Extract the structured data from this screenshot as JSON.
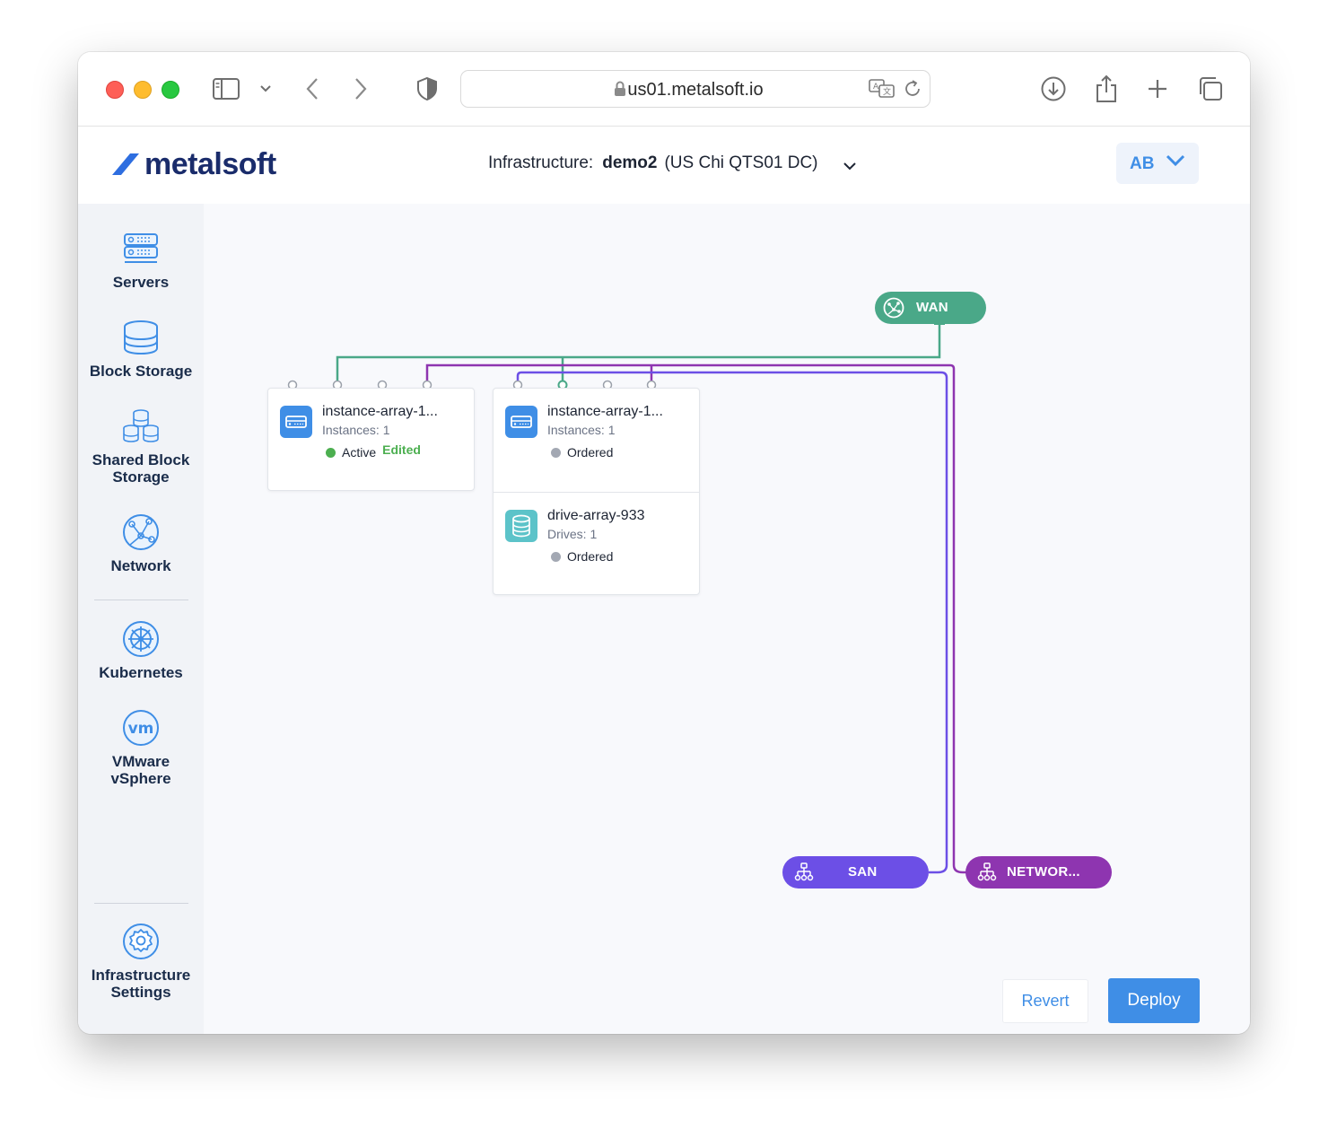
{
  "browser": {
    "url": "us01.metalsoft.io"
  },
  "header": {
    "logo_text": "metalsoft",
    "infra_label": "Infrastructure:",
    "infra_name": "demo2",
    "infra_location": "(US Chi QTS01 DC)",
    "user_initials": "AB"
  },
  "sidebar": {
    "items": [
      {
        "label": "Servers",
        "icon": "server-icon"
      },
      {
        "label": "Block Storage",
        "icon": "database-icon"
      },
      {
        "label_line1": "Shared Block",
        "label_line2": "Storage",
        "icon": "shared-storage-icon"
      },
      {
        "label": "Network",
        "icon": "network-globe-icon"
      },
      {
        "label": "Kubernetes",
        "icon": "kubernetes-icon"
      },
      {
        "label_line1": "VMware",
        "label_line2": "vSphere",
        "icon": "vmware-icon"
      },
      {
        "label_line1": "Infrastructure",
        "label_line2": "Settings",
        "icon": "gear-icon"
      }
    ]
  },
  "canvas": {
    "cards": [
      {
        "title": "instance-array-1...",
        "sub": "Instances: 1",
        "status": "Active",
        "edited": "Edited",
        "status_color": "#4caf50"
      },
      {
        "title": "instance-array-1...",
        "sub": "Instances: 1",
        "status": "Ordered",
        "status_color": "#a3a8b3"
      },
      {
        "title": "drive-array-933",
        "sub": "Drives: 1",
        "status": "Ordered",
        "status_color": "#a3a8b3"
      }
    ],
    "networks": {
      "wan": {
        "label": "WAN",
        "color": "#4aa888"
      },
      "san": {
        "label": "SAN",
        "color": "#6c4fe6"
      },
      "other": {
        "label": "NETWOR...",
        "color": "#8e35b0"
      }
    }
  },
  "actions": {
    "revert": "Revert",
    "deploy": "Deploy"
  }
}
